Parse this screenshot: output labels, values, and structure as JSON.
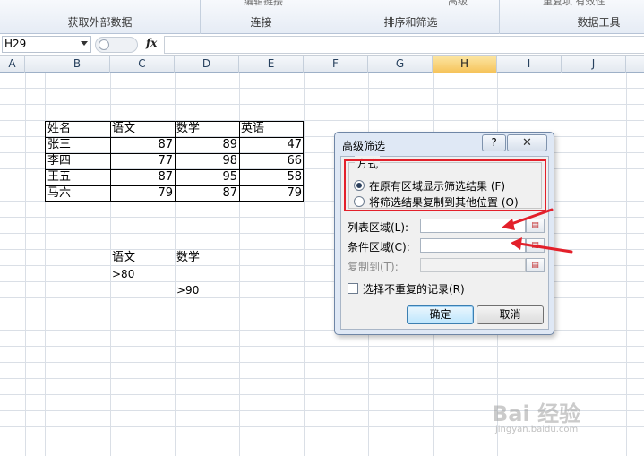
{
  "ribbon": {
    "groups": [
      {
        "label": "获取外部数据"
      },
      {
        "label": "连接",
        "top_text": "编辑链接"
      },
      {
        "label": "排序和筛选",
        "top_text": "高级"
      },
      {
        "label": "数据工具",
        "top_text": "重复项  有效性"
      }
    ]
  },
  "formula_bar": {
    "name_box": "H29",
    "fx_label": "fx",
    "formula": ""
  },
  "columns": [
    "A",
    "B",
    "C",
    "D",
    "E",
    "F",
    "G",
    "H",
    "I",
    "J"
  ],
  "active_column": "H",
  "sheet": {
    "table_header": [
      "姓名",
      "语文",
      "数学",
      "英语"
    ],
    "table_rows": [
      [
        "张三",
        "87",
        "89",
        "47"
      ],
      [
        "李四",
        "77",
        "98",
        "66"
      ],
      [
        "王五",
        "87",
        "95",
        "58"
      ],
      [
        "马六",
        "79",
        "87",
        "79"
      ]
    ],
    "criteria_header": [
      "语文",
      "数学"
    ],
    "criteria_values": [
      ">80",
      ">90"
    ]
  },
  "dialog": {
    "title": "高级筛选",
    "help_btn": "?",
    "close_btn": "✕",
    "group_title": "方式",
    "radio_1": "在原有区域显示筛选结果 (F)",
    "radio_2": "将筛选结果复制到其他位置 (O)",
    "radio_selected": 1,
    "list_range_label": "列表区域(L):",
    "criteria_range_label": "条件区域(C):",
    "copy_to_label": "复制到(T):",
    "list_range_value": "",
    "criteria_range_value": "",
    "copy_to_value": "",
    "unique_label": "选择不重复的记录(R)",
    "ok_label": "确定",
    "cancel_label": "取消"
  },
  "watermark": {
    "main": "Bai 经验",
    "sub": "jingyan.baidu.com"
  },
  "colors": {
    "highlight_red": "#e3202a",
    "active_column": "#f6c35a"
  }
}
